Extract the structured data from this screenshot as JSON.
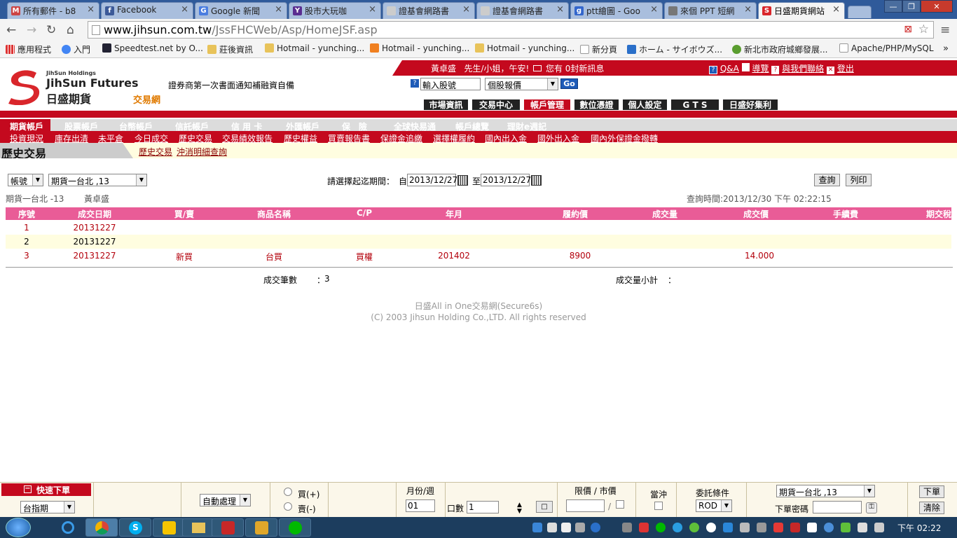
{
  "browser": {
    "tabs": [
      {
        "label": "所有郵件 - b8",
        "icon": "gmail-icon",
        "color": "#c44"
      },
      {
        "label": "Facebook",
        "icon": "facebook-icon",
        "color": "#3b5998"
      },
      {
        "label": "Google 新聞",
        "icon": "google-news-icon",
        "color": "#4a7de0"
      },
      {
        "label": "股市大玩咖",
        "icon": "yahoo-icon",
        "color": "#5a2d91"
      },
      {
        "label": "證基會網路書",
        "icon": "page-icon",
        "color": "#aaa"
      },
      {
        "label": "證基會網路書",
        "icon": "page-icon",
        "color": "#aaa"
      },
      {
        "label": "ptt繪圖 - Goo",
        "icon": "google-icon",
        "color": "#3366cc"
      },
      {
        "label": "來個 PPT 短網",
        "icon": "ppt-icon",
        "color": "#777"
      },
      {
        "label": "日盛期貨網站",
        "icon": "jihsun-icon",
        "color": "#d9262b"
      }
    ],
    "url_host": "www.jihsun.com.tw",
    "url_path": "/JssFHCWeb/Asp/HomeJSF.asp",
    "bookmarks": [
      {
        "label": "應用程式",
        "color": "#d33"
      },
      {
        "label": "入門",
        "color": "#4285f4"
      },
      {
        "label": "Speedtest.net by O...",
        "color": "#223"
      },
      {
        "label": "莊後資訊",
        "color": "#e8c35a"
      },
      {
        "label": "Hotmail - yunching...",
        "color": "#e8c35a"
      },
      {
        "label": "Hotmail - yunching...",
        "color": "#f08020"
      },
      {
        "label": "Hotmail - yunching...",
        "color": "#e8c35a"
      },
      {
        "label": "新分頁",
        "color": "#ddd"
      },
      {
        "label": "ホーム - サイボウズ...",
        "color": "#2a6fc9"
      },
      {
        "label": "新北市政府城鄉發展...",
        "color": "#5a9d2f"
      },
      {
        "label": "Apache/PHP/MySQL",
        "color": "#ddd"
      }
    ]
  },
  "site": {
    "logo_small": "JihSun Holdings",
    "logo_en": "JihSun Futures",
    "logo_zh": "日盛期貨",
    "logo_sub": "交易網",
    "greeting_name": "黃卓盛",
    "greeting_text": "先生/小姐，午安!",
    "messages": "您有 0封新訊息",
    "links": [
      "Q&A",
      "導覽",
      "與我們聯絡",
      "登出"
    ],
    "marquee": "證券商第一次書面通知補融資自備",
    "quote_input": "輸入股號",
    "quote_select": "個股報價",
    "go_label": "Go",
    "menu": [
      "市場資訊",
      "交易中心",
      "帳戶管理",
      "數位憑證",
      "個人設定",
      "G T S",
      "日盛好集利"
    ]
  },
  "nav": {
    "row1": [
      "期貨帳戶",
      "股票帳戶",
      "台幣帳戶",
      "信託帳戶",
      "信 用 卡",
      "外匯帳戶",
      "保　險",
      "全球快易通",
      "帳戶總覽",
      "理財e週記"
    ],
    "row2": [
      "投資現況",
      "庫存出清",
      "未平倉",
      "今日成交",
      "歷史交易",
      "交易績效報告",
      "歷史權益",
      "買賣報告書",
      "保證金追繳",
      "選擇權履約",
      "國內出入金",
      "國外出入金",
      "國內外保證金撥轉"
    ],
    "page_title": "歷史交易",
    "row3": [
      "歷史交易",
      "沖消明細查詢"
    ]
  },
  "form": {
    "account_type": "帳號",
    "account": "期貨一台北 ,13",
    "period_label": "請選擇起迄期間：",
    "from_label": "自",
    "from_date": "2013/12/27",
    "to_label": "至",
    "to_date": "2013/12/27",
    "query_btn": "查詢",
    "print_btn": "列印",
    "account_info": "期貨一台北 -13",
    "account_name": "黃卓盛",
    "query_time": "查詢時間:2013/12/30 下午 02:22:15"
  },
  "table": {
    "headers": [
      "序號",
      "成交日期",
      "買/賣",
      "商品名稱",
      "C/P",
      "年月",
      "履約價",
      "成交量",
      "成交價",
      "手續費",
      "期交稅"
    ],
    "rows": [
      [
        "1",
        "20131227",
        "",
        "",
        "",
        "",
        "",
        "",
        "",
        "",
        ""
      ],
      [
        "2",
        "20131227",
        "",
        "",
        "",
        "",
        "",
        "",
        "",
        "",
        ""
      ],
      [
        "3",
        "20131227",
        "新買",
        "台買",
        "買權",
        "201402",
        "8900",
        "",
        "14.000",
        "",
        ""
      ]
    ]
  },
  "summary": {
    "count_label": "成交筆數",
    "count_colon": "：",
    "count_value": "3",
    "qty_label": "成交量小計",
    "qty_colon": "："
  },
  "footer": {
    "line1": "日盛All in One交易網(Secure6s)",
    "line2": "(C) 2003 Jihsun Holding Co.,LTD. All rights reserved"
  },
  "orderbar": {
    "title": "快速下單",
    "product": "台指期",
    "auto": "自動處理",
    "buy": "買(+)",
    "sell": "賣(-)",
    "month_label": "月份/週",
    "month_value": "01",
    "qty_label": "口數",
    "qty_value": "1",
    "price_label": "限價 / 市價",
    "slash": "/",
    "offset_label": "當沖",
    "cond_label": "委託條件",
    "cond_value": "ROD",
    "account": "期貨一台北 ,13",
    "pwd_label": "下單密碼",
    "submit": "下單",
    "clear": "清除"
  },
  "taskbar": {
    "clock": "下午 02:22"
  }
}
